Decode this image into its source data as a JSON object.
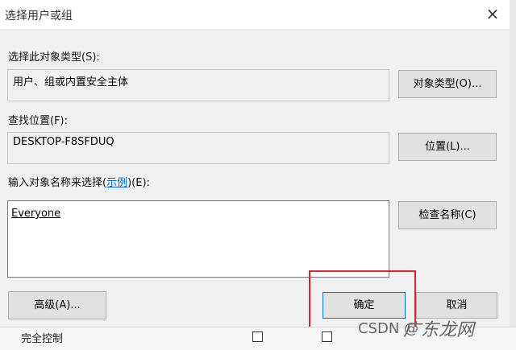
{
  "window": {
    "title": "选择用户或组",
    "close_icon": "×"
  },
  "object_type": {
    "label": "选择此对象类型(S):",
    "value": "用户、组或内置安全主体",
    "button": "对象类型(O)..."
  },
  "location": {
    "label": "查找位置(F):",
    "value": "DESKTOP-F8SFDUQ",
    "button": "位置(L)..."
  },
  "names": {
    "label_prefix": "输入对象名称来选择(",
    "label_link": "示例",
    "label_suffix": ")(E):",
    "value": "Everyone",
    "check_button": "检查名称(C)"
  },
  "footer": {
    "advanced_button": "高级(A)...",
    "ok_button": "确定",
    "cancel_button": "取消"
  },
  "background": {
    "row_label": "完全控制"
  },
  "watermark": {
    "left": "CSDN @",
    "right": "广东龙网"
  },
  "colors": {
    "highlight_box": "#d9252d",
    "link": "#0066cc"
  }
}
